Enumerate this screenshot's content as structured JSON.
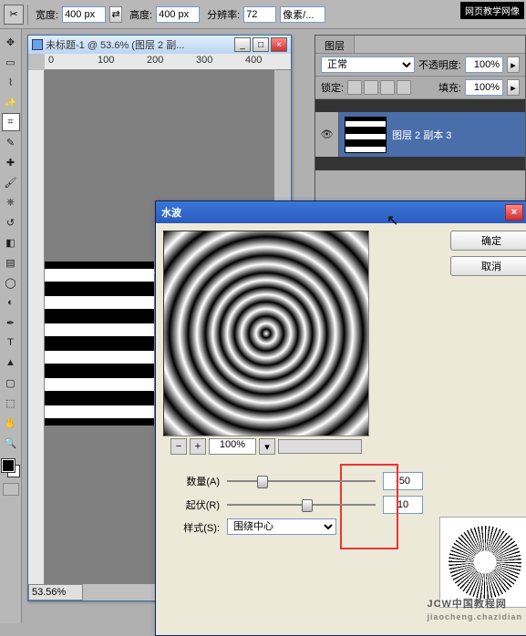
{
  "options_bar": {
    "width_label": "宽度:",
    "width_value": "400 px",
    "height_label": "高度:",
    "height_value": "400 px",
    "resolution_label": "分辨率:",
    "resolution_value": "72",
    "unit_label": "像素/..."
  },
  "document": {
    "title": "未标题-1 @ 53.6% (图层 2 副...",
    "zoom_status": "53.56%",
    "ruler_marks": [
      "0",
      "100",
      "200",
      "300",
      "400"
    ]
  },
  "layers": {
    "tab": "图层",
    "blend_mode": "正常",
    "opacity_label": "不透明度:",
    "opacity_value": "100%",
    "lock_label": "锁定:",
    "fill_label": "填充:",
    "fill_value": "100%",
    "layer_name": "图层 2 副本 3"
  },
  "dialog": {
    "title": "水波",
    "ok": "确定",
    "cancel": "取消",
    "zoom": "100%",
    "amount_label": "数量(A)",
    "amount_value": "-50",
    "ridges_label": "起伏(R)",
    "ridges_value": "10",
    "style_label": "样式(S):",
    "style_value": "围绕中心"
  },
  "watermark": {
    "big": "JCW中国教程网",
    "small": "jiaocheng.chazidian",
    "badge": "网页教学网像"
  }
}
